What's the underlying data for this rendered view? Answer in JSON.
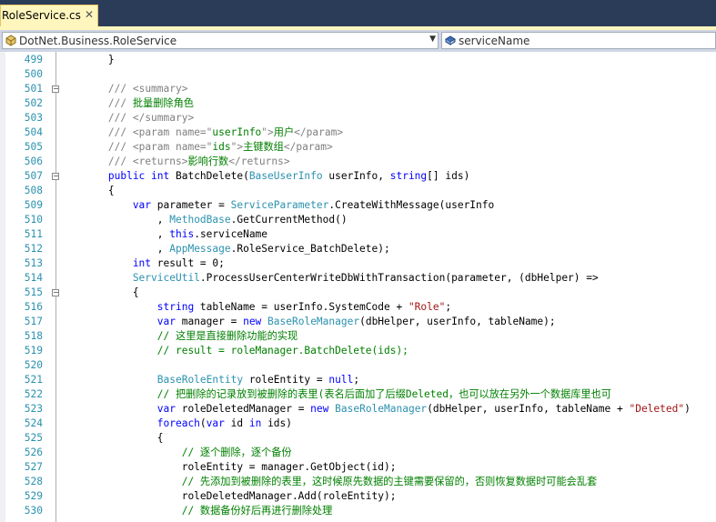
{
  "tab": {
    "label": "RoleService.cs",
    "close": "✕"
  },
  "nav": {
    "type_dropdown": "DotNet.Business.RoleService",
    "member_dropdown": "serviceName"
  },
  "code": {
    "lines": [
      {
        "n": "499",
        "tokens": [
          {
            "c": "n",
            "t": "        }"
          }
        ]
      },
      {
        "n": "500",
        "tokens": []
      },
      {
        "n": "501",
        "tokens": [
          {
            "c": "g",
            "t": "        ///"
          },
          {
            "c": "c",
            "t": " "
          },
          {
            "c": "g",
            "t": "<summary>"
          }
        ]
      },
      {
        "n": "502",
        "tokens": [
          {
            "c": "g",
            "t": "        ///"
          },
          {
            "c": "c",
            "t": " 批量删除角色"
          }
        ]
      },
      {
        "n": "503",
        "tokens": [
          {
            "c": "g",
            "t": "        ///"
          },
          {
            "c": "c",
            "t": " "
          },
          {
            "c": "g",
            "t": "</summary>"
          }
        ]
      },
      {
        "n": "504",
        "tokens": [
          {
            "c": "g",
            "t": "        ///"
          },
          {
            "c": "c",
            "t": " "
          },
          {
            "c": "g",
            "t": "<param name=\""
          },
          {
            "c": "c",
            "t": "userInfo"
          },
          {
            "c": "g",
            "t": "\">"
          },
          {
            "c": "c",
            "t": "用户"
          },
          {
            "c": "g",
            "t": "</param>"
          }
        ]
      },
      {
        "n": "505",
        "tokens": [
          {
            "c": "g",
            "t": "        ///"
          },
          {
            "c": "c",
            "t": " "
          },
          {
            "c": "g",
            "t": "<param name=\""
          },
          {
            "c": "c",
            "t": "ids"
          },
          {
            "c": "g",
            "t": "\">"
          },
          {
            "c": "c",
            "t": "主键数组"
          },
          {
            "c": "g",
            "t": "</param>"
          }
        ]
      },
      {
        "n": "506",
        "tokens": [
          {
            "c": "g",
            "t": "        ///"
          },
          {
            "c": "c",
            "t": " "
          },
          {
            "c": "g",
            "t": "<returns>"
          },
          {
            "c": "c",
            "t": "影响行数"
          },
          {
            "c": "g",
            "t": "</returns>"
          }
        ]
      },
      {
        "n": "507",
        "tokens": [
          {
            "c": "k",
            "t": "        public int"
          },
          {
            "c": "n",
            "t": " BatchDelete("
          },
          {
            "c": "t",
            "t": "BaseUserInfo"
          },
          {
            "c": "n",
            "t": " userInfo, "
          },
          {
            "c": "k",
            "t": "string"
          },
          {
            "c": "n",
            "t": "[] ids)"
          }
        ]
      },
      {
        "n": "508",
        "tokens": [
          {
            "c": "n",
            "t": "        {"
          }
        ]
      },
      {
        "n": "509",
        "tokens": [
          {
            "c": "k",
            "t": "            var"
          },
          {
            "c": "n",
            "t": " parameter = "
          },
          {
            "c": "t",
            "t": "ServiceParameter"
          },
          {
            "c": "n",
            "t": ".CreateWithMessage(userInfo"
          }
        ]
      },
      {
        "n": "510",
        "tokens": [
          {
            "c": "n",
            "t": "                , "
          },
          {
            "c": "t",
            "t": "MethodBase"
          },
          {
            "c": "n",
            "t": ".GetCurrentMethod()"
          }
        ]
      },
      {
        "n": "511",
        "tokens": [
          {
            "c": "n",
            "t": "                , "
          },
          {
            "c": "k",
            "t": "this"
          },
          {
            "c": "n",
            "t": ".serviceName"
          }
        ]
      },
      {
        "n": "512",
        "tokens": [
          {
            "c": "n",
            "t": "                , "
          },
          {
            "c": "t",
            "t": "AppMessage"
          },
          {
            "c": "n",
            "t": ".RoleService_BatchDelete);"
          }
        ]
      },
      {
        "n": "513",
        "tokens": [
          {
            "c": "k",
            "t": "            int"
          },
          {
            "c": "n",
            "t": " result = 0;"
          }
        ]
      },
      {
        "n": "514",
        "tokens": [
          {
            "c": "t",
            "t": "            ServiceUtil"
          },
          {
            "c": "n",
            "t": ".ProcessUserCenterWriteDbWithTransaction(parameter, (dbHelper) =>"
          }
        ]
      },
      {
        "n": "515",
        "tokens": [
          {
            "c": "n",
            "t": "            {"
          }
        ]
      },
      {
        "n": "516",
        "tokens": [
          {
            "c": "k",
            "t": "                string"
          },
          {
            "c": "n",
            "t": " tableName = userInfo.SystemCode + "
          },
          {
            "c": "s",
            "t": "\"Role\""
          },
          {
            "c": "n",
            "t": ";"
          }
        ]
      },
      {
        "n": "517",
        "tokens": [
          {
            "c": "k",
            "t": "                var"
          },
          {
            "c": "n",
            "t": " manager = "
          },
          {
            "c": "k",
            "t": "new"
          },
          {
            "c": "n",
            "t": " "
          },
          {
            "c": "t",
            "t": "BaseRoleManager"
          },
          {
            "c": "n",
            "t": "(dbHelper, userInfo, tableName);"
          }
        ]
      },
      {
        "n": "518",
        "tokens": [
          {
            "c": "c",
            "t": "                // 这里是直接删除功能的实现"
          }
        ]
      },
      {
        "n": "519",
        "tokens": [
          {
            "c": "c",
            "t": "                // result = roleManager.BatchDelete(ids);"
          }
        ]
      },
      {
        "n": "520",
        "tokens": []
      },
      {
        "n": "521",
        "tokens": [
          {
            "c": "t",
            "t": "                BaseRoleEntity"
          },
          {
            "c": "n",
            "t": " roleEntity = "
          },
          {
            "c": "k",
            "t": "null"
          },
          {
            "c": "n",
            "t": ";"
          }
        ]
      },
      {
        "n": "522",
        "tokens": [
          {
            "c": "c",
            "t": "                // 把删除的记录放到被删除的表里(表名后面加了后缀Deleted，也可以放在另外一个数据库里也可"
          }
        ]
      },
      {
        "n": "523",
        "tokens": [
          {
            "c": "k",
            "t": "                var"
          },
          {
            "c": "n",
            "t": " roleDeletedManager = "
          },
          {
            "c": "k",
            "t": "new"
          },
          {
            "c": "n",
            "t": " "
          },
          {
            "c": "t",
            "t": "BaseRoleManager"
          },
          {
            "c": "n",
            "t": "(dbHelper, userInfo, tableName + "
          },
          {
            "c": "s",
            "t": "\"Deleted\""
          },
          {
            "c": "n",
            "t": ")"
          }
        ]
      },
      {
        "n": "524",
        "tokens": [
          {
            "c": "k",
            "t": "                foreach"
          },
          {
            "c": "n",
            "t": "("
          },
          {
            "c": "k",
            "t": "var"
          },
          {
            "c": "n",
            "t": " id "
          },
          {
            "c": "k",
            "t": "in"
          },
          {
            "c": "n",
            "t": " ids)"
          }
        ]
      },
      {
        "n": "525",
        "tokens": [
          {
            "c": "n",
            "t": "                {"
          }
        ]
      },
      {
        "n": "526",
        "tokens": [
          {
            "c": "c",
            "t": "                    // 逐个删除，逐个备份"
          }
        ]
      },
      {
        "n": "527",
        "tokens": [
          {
            "c": "n",
            "t": "                    roleEntity = manager.GetObject(id);"
          }
        ]
      },
      {
        "n": "528",
        "tokens": [
          {
            "c": "c",
            "t": "                    // 先添加到被删除的表里，这时候原先数据的主键需要保留的，否则恢复数据时可能会乱套"
          }
        ]
      },
      {
        "n": "529",
        "tokens": [
          {
            "c": "n",
            "t": "                    roleDeletedManager.Add(roleEntity);"
          }
        ]
      },
      {
        "n": "530",
        "tokens": [
          {
            "c": "c",
            "t": "                    // 数据备份好后再进行删除处理"
          }
        ]
      }
    ]
  },
  "colors": {
    "tabbar_bg": "#2b3c59",
    "active_tab": "#fff6bd",
    "keyword": "#0000ff",
    "type": "#2b91af",
    "string": "#a31515",
    "comment": "#008000",
    "line_number": "#2b91af"
  }
}
